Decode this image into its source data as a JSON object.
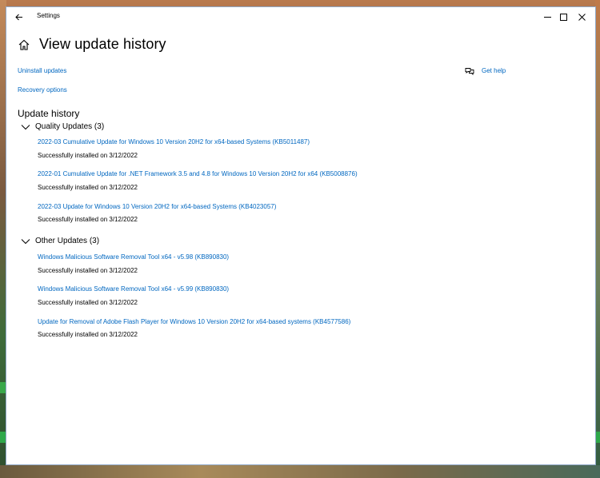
{
  "window": {
    "title": "Settings"
  },
  "header": {
    "title": "View update history"
  },
  "links": {
    "uninstall": "Uninstall updates",
    "recovery": "Recovery options",
    "help": "Get help"
  },
  "history": {
    "heading": "Update history",
    "groups": [
      {
        "title": "Quality Updates (3)",
        "items": [
          {
            "name": "2022-03 Cumulative Update for Windows 10 Version 20H2 for x64-based Systems (KB5011487)",
            "status": "Successfully installed on 3/12/2022"
          },
          {
            "name": "2022-01 Cumulative Update for .NET Framework 3.5 and 4.8 for Windows 10 Version 20H2 for x64 (KB5008876)",
            "status": "Successfully installed on 3/12/2022"
          },
          {
            "name": "2022-03 Update for Windows 10 Version 20H2 for x64-based Systems (KB4023057)",
            "status": "Successfully installed on 3/12/2022"
          }
        ]
      },
      {
        "title": "Other Updates (3)",
        "items": [
          {
            "name": "Windows Malicious Software Removal Tool x64 - v5.98 (KB890830)",
            "status": "Successfully installed on 3/12/2022"
          },
          {
            "name": "Windows Malicious Software Removal Tool x64 - v5.99 (KB890830)",
            "status": "Successfully installed on 3/12/2022"
          },
          {
            "name": "Update for Removal of Adobe Flash Player for Windows 10 Version 20H2 for x64-based systems (KB4577586)",
            "status": "Successfully installed on 3/12/2022"
          }
        ]
      }
    ]
  },
  "colors": {
    "link": "#0067c0",
    "text": "#000000",
    "background": "#ffffff"
  }
}
